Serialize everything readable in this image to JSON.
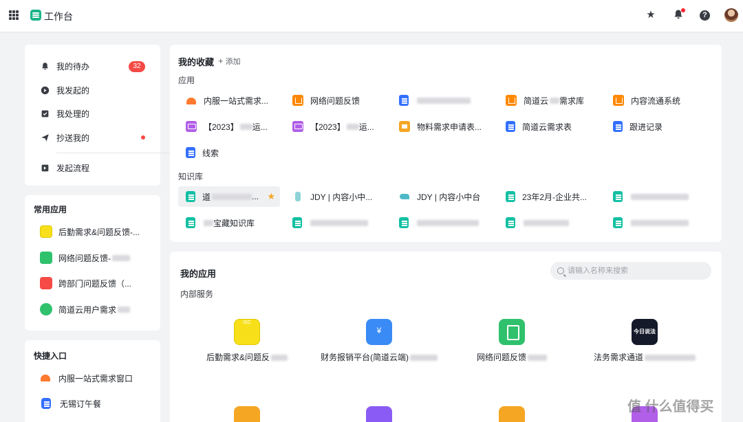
{
  "header": {
    "title": "工作台"
  },
  "sidebar_nav": {
    "items": [
      {
        "label": "我的待办",
        "badge": "32"
      },
      {
        "label": "我发起的"
      },
      {
        "label": "我处理的"
      },
      {
        "label": "抄送我的"
      },
      {
        "label": "发起流程"
      }
    ]
  },
  "common_apps": {
    "title": "常用应用",
    "items": [
      {
        "label": "后勤需求&问题反馈-..."
      },
      {
        "label": "网络问题反馈-"
      },
      {
        "label": "跨部门问题反馈（..."
      },
      {
        "label": "简道云用户需求"
      }
    ]
  },
  "shortcuts": {
    "title": "快捷入口",
    "items": [
      {
        "label": "内服一站式需求窗口"
      },
      {
        "label": "无锡订午餐"
      }
    ]
  },
  "favorites": {
    "title": "我的收藏",
    "add_label": "添加",
    "apps_title": "应用",
    "apps": [
      {
        "label": "内服一站式需求...",
        "icon": "alarm-icon"
      },
      {
        "label": "网络问题反馈",
        "icon": "org-chart-icon"
      },
      {
        "label": "",
        "icon": "doc-icon"
      },
      {
        "label": "简道云",
        "label_suffix": "需求库",
        "icon": "org-chart-icon"
      },
      {
        "label": "内容流通系统",
        "icon": "org-chart-icon"
      },
      {
        "label": "【2023】",
        "label_suffix": "运...",
        "icon": "monitor-icon"
      },
      {
        "label": "【2023】",
        "label_suffix": "运...",
        "icon": "monitor-icon"
      },
      {
        "label": "物料需求申请表...",
        "icon": "box-icon"
      },
      {
        "label": "简道云需求表",
        "icon": "doc-icon"
      },
      {
        "label": "跟进记录",
        "icon": "doc-icon"
      },
      {
        "label": "线索",
        "icon": "doc-icon"
      }
    ],
    "kb_title": "知识库",
    "kb": [
      {
        "label": "道",
        "label_suffix": "...",
        "icon": "sheet-icon",
        "starred": true
      },
      {
        "label": "JDY | 内容小中...",
        "icon": "bottle-icon"
      },
      {
        "label": "JDY | 内容小中台",
        "icon": "dolphin-icon"
      },
      {
        "label": "23年2月-企业共...",
        "icon": "sheet-icon"
      },
      {
        "label": "",
        "icon": "sheet-icon"
      },
      {
        "label": "宝藏知识库",
        "icon": "sheet-icon"
      },
      {
        "label": "",
        "icon": "sheet-icon"
      },
      {
        "label": "",
        "icon": "sheet-icon"
      },
      {
        "label": "",
        "icon": "sheet-icon"
      },
      {
        "label": "",
        "icon": "sheet-icon"
      }
    ]
  },
  "my_apps": {
    "title": "我的应用",
    "search_placeholder": "请输入名称来搜索",
    "group_title": "内部服务",
    "items": [
      {
        "label": "后勤需求&问题反"
      },
      {
        "label": "财务报销平台(简道云端)"
      },
      {
        "label": "网络问题反馈"
      },
      {
        "label": "法务需求通道"
      }
    ]
  },
  "watermark": "值 什么值得买",
  "colors": {
    "accent": "#3370ff",
    "badge": "#f54a45",
    "brand": "#1cb58a"
  }
}
